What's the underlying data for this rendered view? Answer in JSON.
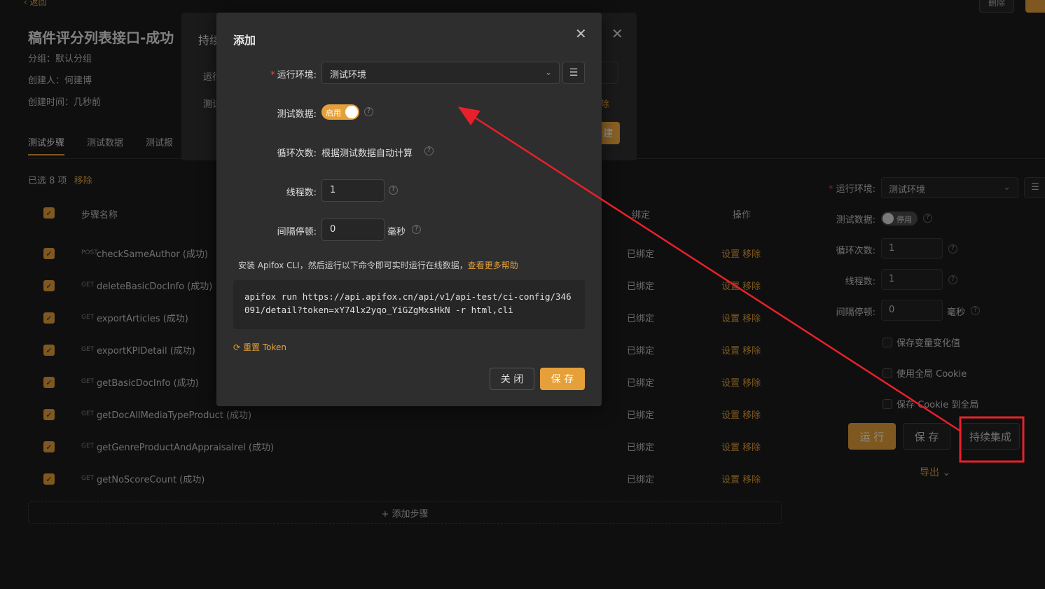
{
  "page": {
    "back": "‹ 返回",
    "top_delete": "删除",
    "title": "稿件评分列表接口-成功",
    "group": "分组：默认分组",
    "creator": "创建人：何建博",
    "created": "创建时间：几秒前",
    "tabs": [
      "测试步骤",
      "测试数据",
      "测试报"
    ],
    "selected_count": "已选 8 项",
    "remove_link": "移除",
    "col_name": "步骤名称",
    "col_bind": "绑定",
    "col_ops": "操作",
    "rows": [
      {
        "method": "POST",
        "name": "checkSameAuthor (成功)",
        "bind": "已绑定",
        "ops": "设置 移除"
      },
      {
        "method": "GET",
        "name": "deleteBasicDocInfo (成功)",
        "bind": "已绑定",
        "ops": "设置 移除"
      },
      {
        "method": "GET",
        "name": "exportArticles (成功)",
        "bind": "已绑定",
        "ops": "设置 移除"
      },
      {
        "method": "GET",
        "name": "exportKPIDetail (成功)",
        "bind": "已绑定",
        "ops": "设置 移除"
      },
      {
        "method": "GET",
        "name": "getBasicDocInfo (成功)",
        "bind": "已绑定",
        "ops": "设置 移除"
      },
      {
        "method": "GET",
        "name": "getDocAllMediaTypeProduct (成功)",
        "bind": "已绑定",
        "ops": "设置 移除"
      },
      {
        "method": "GET",
        "name": "getGenreProductAndAppraisalrel (成功)",
        "bind": "已绑定",
        "ops": "设置 移除"
      },
      {
        "method": "GET",
        "name": "getNoScoreCount (成功)",
        "bind": "已绑定",
        "ops": "设置 移除"
      }
    ],
    "add_step": "+ 添加步骤"
  },
  "right_panel": {
    "env_label": "运行环境:",
    "env_value": "测试环境",
    "data_label": "测试数据:",
    "data_toggle": "停用",
    "loop_label": "循环次数:",
    "loop_value": "1",
    "threads_label": "线程数:",
    "threads_value": "1",
    "interval_label": "间隔停顿:",
    "interval_value": "0",
    "interval_unit": "毫秒",
    "check_1": "保存变量变化值",
    "check_2": "使用全局 Cookie",
    "check_3": "保存 Cookie 到全局",
    "run": "运 行",
    "save": "保 存",
    "ci": "持续集成",
    "export": "导出 ⌄"
  },
  "bg_dialog": {
    "title": "持续",
    "label1": "运行",
    "label2": "测试",
    "action": "除",
    "button": "建"
  },
  "dialog": {
    "title": "添加",
    "env_label": "运行环境:",
    "env_value": "测试环境",
    "data_label": "测试数据:",
    "data_toggle": "启用",
    "loop_label": "循环次数:",
    "loop_text": "根据测试数据自动计算",
    "threads_label": "线程数:",
    "threads_value": "1",
    "interval_label": "间隔停顿:",
    "interval_value": "0",
    "interval_unit": "毫秒",
    "cli_hint": "安装 Apifox CLI，然后运行以下命令即可实时运行在线数据，",
    "cli_help": "查看更多帮助",
    "command": "apifox run https://api.apifox.cn/api/v1/api-test/ci-config/346091/detail?token=xY74lx2yqo_YiGZgMxsHkN -r html,cli",
    "reset_token": "重置 Token",
    "close": "关 闭",
    "save": "保 存"
  },
  "colors": {
    "accent": "#e5a03a",
    "annotation": "#e8202a"
  }
}
